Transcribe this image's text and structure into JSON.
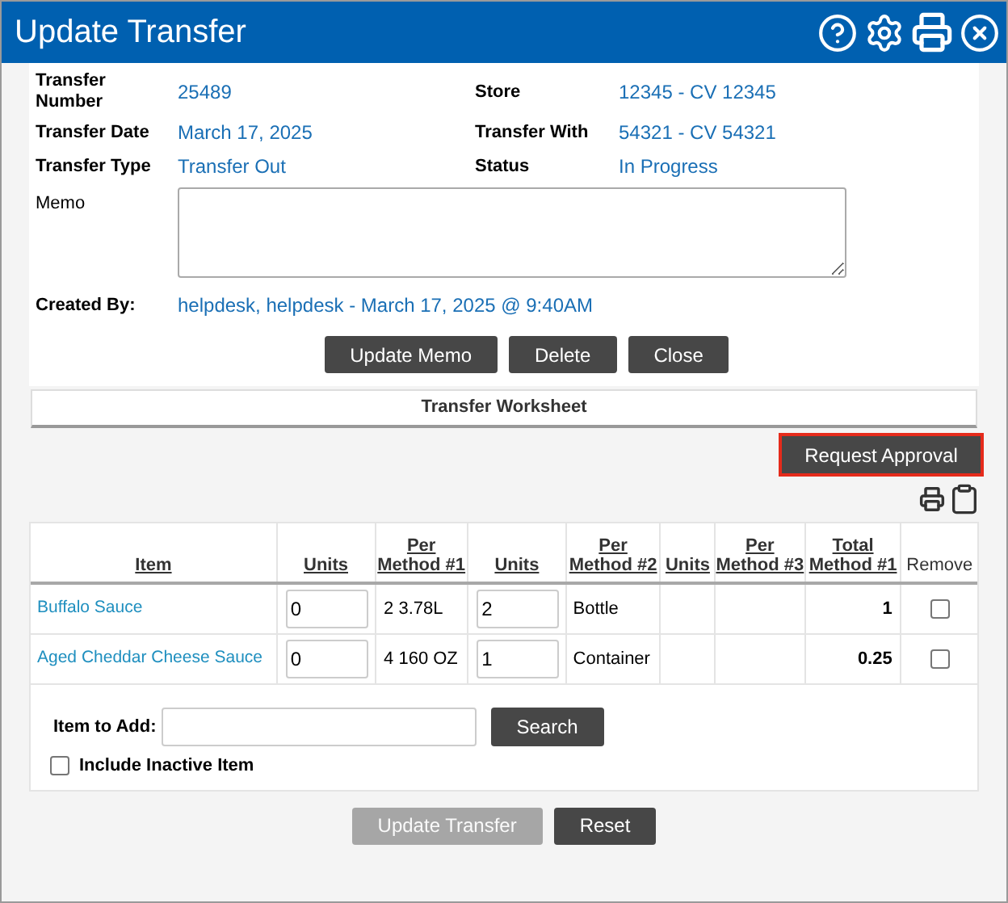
{
  "window": {
    "title": "Update Transfer"
  },
  "fields": [
    {
      "label": "Transfer Number",
      "value": "25489"
    },
    {
      "label": "Store",
      "value": "12345 - CV 12345"
    },
    {
      "label": "Transfer Date",
      "value": "March 17, 2025"
    },
    {
      "label": "Transfer With",
      "value": "54321 - CV 54321"
    },
    {
      "label": "Transfer Type",
      "value": "Transfer Out"
    },
    {
      "label": "Status",
      "value": "In Progress"
    }
  ],
  "memo": {
    "label": "Memo"
  },
  "created_by": {
    "label": "Created By:",
    "value": "helpdesk, helpdesk - March 17, 2025 @ 9:40AM"
  },
  "memo_buttons": [
    {
      "label": "Update Memo",
      "disabled": false
    },
    {
      "label": "Delete",
      "disabled": false
    },
    {
      "label": "Close",
      "disabled": false
    }
  ],
  "worksheet": {
    "title": "Transfer Worksheet",
    "request_button": {
      "label": "Request Approval",
      "highlighted": true
    }
  },
  "table": {
    "columns": [
      "Item",
      "Units",
      "Per Method #1",
      "Units",
      "Per Method #2",
      "Units",
      "Per Method #3",
      "Total Method #1",
      "Remove"
    ],
    "rows": [
      {
        "item": "Buffalo Sauce",
        "units_1": "0",
        "per_method_1": "2 3.78L",
        "units_2": "2",
        "per_method_2": "Bottle",
        "total": "1",
        "remove": false
      },
      {
        "item": "Aged Cheddar Cheese Sauce",
        "units_1": "0",
        "per_method_1": "4 160 OZ",
        "units_2": "1",
        "per_method_2": "Container",
        "total": "0.25",
        "remove": false
      }
    ]
  },
  "add_item": {
    "label": "Item to Add:",
    "search_button": "Search",
    "include_inactive": {
      "label": "Include Inactive Item",
      "checked": false
    }
  },
  "footer_buttons": [
    {
      "label": "Update Transfer",
      "disabled": true
    },
    {
      "label": "Reset",
      "disabled": false
    }
  ]
}
